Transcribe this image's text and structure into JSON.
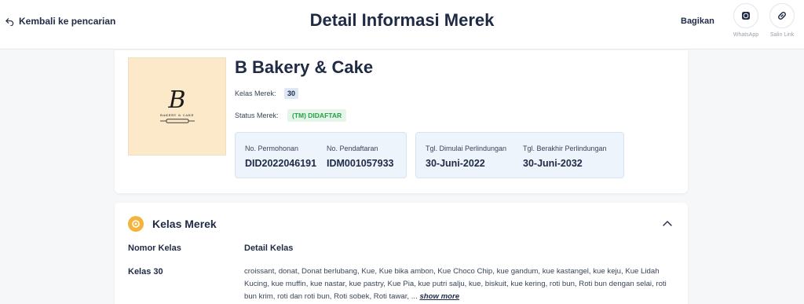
{
  "header": {
    "back_label": "Kembali ke pencarian",
    "title": "Detail Informasi Merek",
    "share_label": "Bagikan",
    "whatsapp_label": "WhatsApp",
    "copy_link_label": "Salin Link"
  },
  "brand": {
    "name": "B Bakery & Cake",
    "logo_letter": "B",
    "logo_text": "BAKERY & CAKE",
    "class_label": "Kelas Merek:",
    "class_value": "30",
    "status_label": "Status Merek:",
    "status_value": "(TM) DIDAFTAR"
  },
  "registration": {
    "application_no_label": "No. Permohonan",
    "application_no": "DID2022046191",
    "registration_no_label": "No. Pendaftaran",
    "registration_no": "IDM001057933",
    "protection_start_label": "Tgl. Dimulai Perlindungan",
    "protection_start": "30-Juni-2022",
    "protection_end_label": "Tgl. Berakhir Perlindungan",
    "protection_end": "30-Juni-2032"
  },
  "kelas_section": {
    "title": "Kelas Merek",
    "col_number": "Nomor Kelas",
    "col_detail": "Detail Kelas",
    "rows": [
      {
        "number": "Kelas 30",
        "detail": "croissant, donat, Donat berlubang, Kue, Kue bika ambon, Kue Choco Chip, kue gandum, kue kastangel, kue keju, Kue Lidah Kucing, kue muffin, kue nastar, kue pastry, Kue Pia, kue putri salju, kue, biskuit, kue kering, roti bun, Roti bun dengan selai, roti bun krim, roti dan roti bun, Roti sobek, Roti tawar, ...",
        "show_more": "show more"
      }
    ]
  },
  "colors": {
    "primary_text": "#1f2a44",
    "status_green": "#27a047",
    "info_box_bg": "#eef4fc",
    "kelas_icon": "#f4b33a"
  }
}
